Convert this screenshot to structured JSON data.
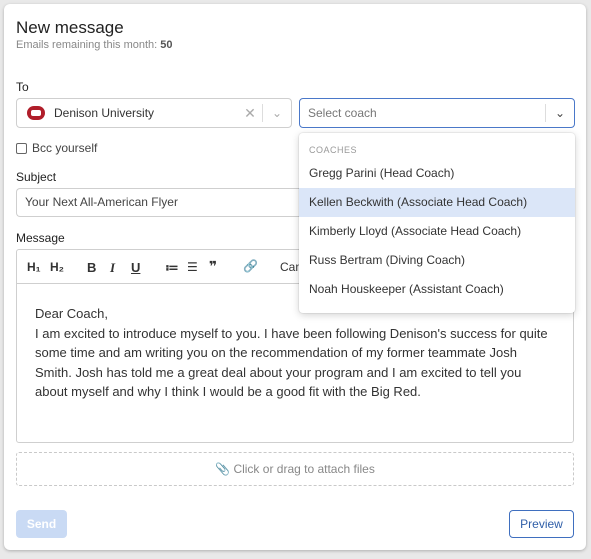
{
  "header": {
    "title": "New message",
    "remaining_label": "Emails remaining this month:",
    "remaining_count": "50"
  },
  "to": {
    "label": "To",
    "school": "Denison University",
    "coach_placeholder": "Select coach"
  },
  "bcc": {
    "label": "Bcc yourself",
    "checked": false
  },
  "subject": {
    "label": "Subject",
    "value": "Your Next All-American Flyer"
  },
  "message": {
    "label": "Message",
    "toolbar": {
      "h1": "H₁",
      "h2": "H₂",
      "bold": "B",
      "italic": "I",
      "underline": "U",
      "ordered_list": "≔",
      "bullet_list": "☰",
      "quote": "❞",
      "link": "🔗",
      "cancel_truncated": "Can"
    },
    "body": {
      "greeting": "Dear Coach,",
      "text": "I am excited to introduce myself to you. I have been following Denison's success for quite some time and am writing you on the recommendation of my former teammate Josh Smith. Josh has told me a great deal about your program and I am excited to tell you about myself and why I think I would be a good fit with the Big Red."
    }
  },
  "attach": {
    "label": "Click or drag to attach files"
  },
  "buttons": {
    "send": "Send",
    "preview": "Preview"
  },
  "coach_menu": {
    "heading": "COACHES",
    "items": [
      "Gregg Parini (Head Coach)",
      "Kellen Beckwith (Associate Head Coach)",
      "Kimberly Lloyd (Associate Head Coach)",
      "Russ Bertram (Diving Coach)",
      "Noah Houskeeper (Assistant Coach)"
    ],
    "highlighted_index": 1
  },
  "colors": {
    "accent": "#3f6fbf",
    "highlight": "#dbe6f8",
    "send_disabled": "#c9daf4",
    "logo": "#b01e2a"
  }
}
